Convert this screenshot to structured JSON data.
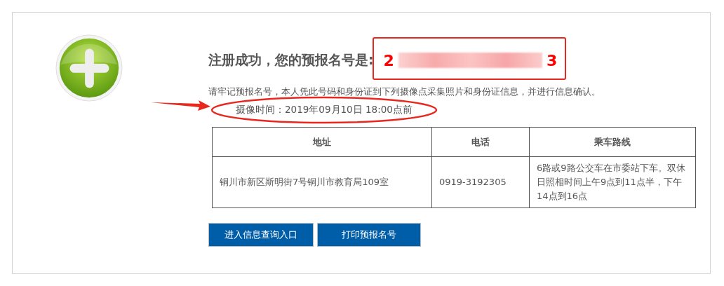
{
  "heading": {
    "label": "注册成功，您的预报名号是:",
    "number_start": "2",
    "number_end": "3",
    "number_redacted": true
  },
  "instruction": "请牢记预报名号，本人凭此号码和身份证到下列摄像点采集照片和身份证信息，并进行信息确认。",
  "photo_time": "摄像时间：2019年09月10日 18:00点前",
  "table": {
    "columns": [
      "地址",
      "电话",
      "乘车路线"
    ],
    "rows": [
      [
        "铜川市新区斯明街7号铜川市教育局109室",
        "0919-3192305",
        "6路或9路公交车在市委站下车。双休日照相时间上午9点到11点半，下午14点到16点"
      ]
    ]
  },
  "buttons": [
    "进入信息查询入口",
    "打印预报名号"
  ],
  "annotations": [
    {
      "kind": "box"
    },
    {
      "kind": "arrow"
    },
    {
      "kind": "ellipse"
    }
  ]
}
